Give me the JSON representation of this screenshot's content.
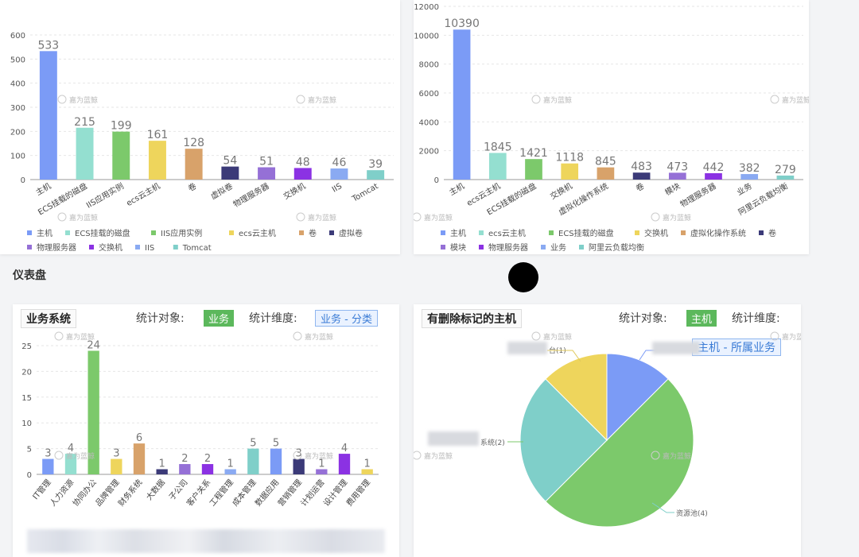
{
  "watermark": "嘉为蓝鲸",
  "colors": [
    "#7b9bf6",
    "#94dfd0",
    "#7cc96b",
    "#eed55c",
    "#d8a26a",
    "#3b3a78",
    "#9570d6",
    "#8b32e3",
    "#8aaaf2",
    "#7fcfc9"
  ],
  "chart_data": [
    {
      "type": "bar",
      "categories": [
        "主机",
        "ECS挂载的磁盘",
        "IIS应用实例",
        "ecs云主机",
        "卷",
        "虚拟卷",
        "物理服务器",
        "交换机",
        "IIS",
        "Tomcat"
      ],
      "values": [
        533,
        215,
        199,
        161,
        128,
        54,
        51,
        48,
        46,
        39
      ],
      "ylim": [
        0,
        600
      ],
      "yticks": [
        "0",
        "100",
        "200",
        "300",
        "400",
        "500",
        "600"
      ],
      "legend": [
        "主机",
        "ECS挂载的磁盘",
        "IIS应用实例",
        "ecs云主机",
        "卷",
        "虚拟卷",
        "物理服务器",
        "交换机",
        "IIS",
        "Tomcat"
      ]
    },
    {
      "type": "bar",
      "categories": [
        "主机",
        "ecs云主机",
        "ECS挂载的磁盘",
        "交换机",
        "虚拟化操作系统",
        "卷",
        "模块",
        "物理服务器",
        "业务",
        "阿里云负载均衡"
      ],
      "values": [
        10390,
        1845,
        1421,
        1118,
        845,
        483,
        473,
        442,
        382,
        279
      ],
      "ylim": [
        0,
        12000
      ],
      "yticks": [
        "0",
        "2000",
        "4000",
        "6000",
        "8000",
        "10000",
        "12000"
      ],
      "legend": [
        "主机",
        "ecs云主机",
        "ECS挂载的磁盘",
        "交换机",
        "虚拟化操作系统",
        "卷",
        "模块",
        "物理服务器",
        "业务",
        "阿里云负载均衡"
      ]
    },
    {
      "type": "bar",
      "categories": [
        "IT管理",
        "人力资源",
        "协同办公",
        "品牌管理",
        "财务系统",
        "大数据",
        "子公司",
        "客户关系",
        "工程管理",
        "成本管理",
        "数据应用",
        "营销管理",
        "计划运营",
        "设计管理",
        "费用管理"
      ],
      "values": [
        3,
        4,
        24,
        3,
        6,
        1,
        2,
        2,
        1,
        5,
        5,
        3,
        1,
        4,
        1
      ],
      "ylim": [
        0,
        25
      ],
      "yticks": [
        "0",
        "5",
        "10",
        "15",
        "20",
        "25"
      ]
    },
    {
      "type": "pie",
      "labels": [
        "台(1)",
        "系统(2)",
        "资源池(4)"
      ],
      "values": [
        1,
        2,
        4,
        1
      ]
    }
  ],
  "dashboard": {
    "section_title": "仪表盘",
    "card1": {
      "title": "业务系统",
      "stat_object_label": "统计对象:",
      "stat_object_value": "业务",
      "stat_dim_label": "统计维度:",
      "stat_dim_value": "业务 - 分类"
    },
    "card2": {
      "title": "有删除标记的主机",
      "stat_object_label": "统计对象:",
      "stat_object_value": "主机",
      "stat_dim_label": "统计维度:",
      "stat_dim_value": "主机 - 所属业务"
    }
  }
}
